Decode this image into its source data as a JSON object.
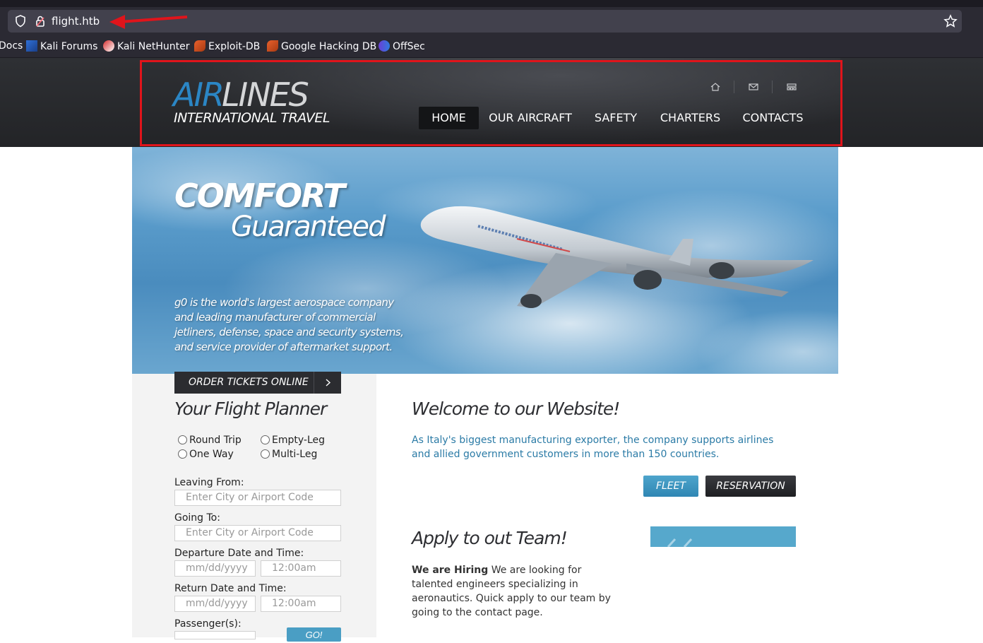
{
  "browser": {
    "url": "flight.htb",
    "bookmarks": [
      {
        "label": "Docs",
        "icon": "docs-icon"
      },
      {
        "label": "Kali Forums",
        "icon": "kali-forums-icon"
      },
      {
        "label": "Kali NetHunter",
        "icon": "kali-nethunter-icon"
      },
      {
        "label": "Exploit-DB",
        "icon": "exploit-db-icon"
      },
      {
        "label": "Google Hacking DB",
        "icon": "google-hacking-db-icon"
      },
      {
        "label": "OffSec",
        "icon": "offsec-icon"
      }
    ]
  },
  "site": {
    "logo_air": "AIR",
    "logo_lines": "LINES",
    "logo_sub": "INTERNATIONAL TRAVEL",
    "nav": [
      "HOME",
      "OUR AIRCRAFT",
      "SAFETY",
      "CHARTERS",
      "CONTACTS"
    ],
    "header_icons": [
      "home-icon",
      "mail-icon",
      "sitemap-icon"
    ]
  },
  "hero": {
    "title1": "COMFORT",
    "title2": "Guaranteed",
    "text": "g0 is the world's largest aerospace company and leading manufacturer of commercial jetliners, defense, space and security systems, and service provider of aftermarket support."
  },
  "planner": {
    "order_label": "ORDER TICKETS ONLINE",
    "title": "Your Flight Planner",
    "trip_types": [
      "Round Trip",
      "Empty-Leg",
      "One Way",
      "Multi-Leg"
    ],
    "leaving_label": "Leaving From:",
    "leaving_placeholder": "Enter City or Airport Code",
    "going_label": "Going To:",
    "going_placeholder": "Enter City or Airport Code",
    "departure_label": "Departure Date and Time:",
    "return_label": "Return Date and Time:",
    "date_placeholder": "mm/dd/yyyy",
    "time_placeholder": "12:00am",
    "passengers_label": "Passenger(s):",
    "go_label": "GO!"
  },
  "main": {
    "welcome_title": "Welcome to our Website!",
    "welcome_text": "As Italy's biggest manufacturing exporter, the company supports airlines and allied government customers in more than 150 countries.",
    "fleet_label": "FLEET",
    "reservation_label": "RESERVATION",
    "apply_title": "Apply to out Team!",
    "apply_bold": "We are Hiring",
    "apply_text": " We are looking for talented engineers specializing in aeronautics. Quick apply to our team by going to the contact page."
  },
  "colors": {
    "accent_blue": "#2b86c5",
    "header_bg": "#2a2b2f",
    "annotation_red": "#e0141b"
  }
}
